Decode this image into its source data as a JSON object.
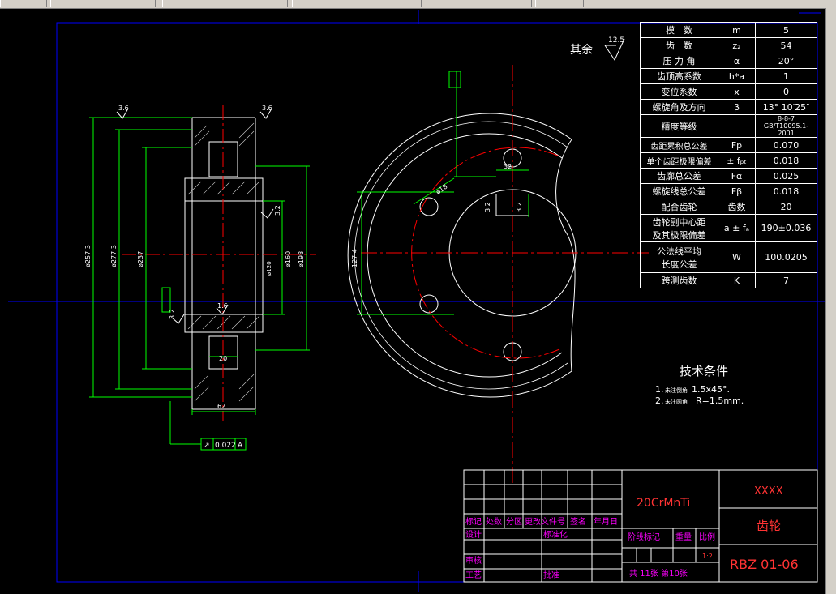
{
  "window": {
    "tabs": [
      "",
      "",
      "",
      "",
      ""
    ],
    "scrollbar": true
  },
  "colors": {
    "background": "#000000",
    "outline": "#ffffff",
    "border": "#0000ff",
    "centerline": "#ff0000",
    "dimension": "#00ff00",
    "text_magenta": "#ff00ff",
    "text_red": "#ff3333",
    "hatch": "#ffffff"
  },
  "roughness": {
    "prefix": "其余",
    "value": "12.5"
  },
  "left_view": {
    "roughness_marks": [
      "3.6",
      "3.6",
      "1.6",
      "3.2",
      "3.2"
    ],
    "dims": {
      "d1": "ø257.3",
      "d2": "ø277.3",
      "d3": "ø237",
      "d4": "ø160",
      "d5": "ø198",
      "d6": "ø120",
      "width": "62",
      "hub": "20"
    },
    "tolerance_box": {
      "symbol": "↗",
      "value": "0.022",
      "datum": "A"
    }
  },
  "right_view": {
    "dim_keyway": "32",
    "dim_angle": "3.2",
    "dim_hole": "ø18",
    "dim_height": "127.4",
    "dim_top": "3.2"
  },
  "spec_table": [
    [
      "模　数",
      "m",
      "5"
    ],
    [
      "齿　数",
      "z₂",
      "54"
    ],
    [
      "压 力 角",
      "α",
      "20°"
    ],
    [
      "齿顶高系数",
      "h*a",
      "1"
    ],
    [
      "变位系数",
      "x",
      "0"
    ],
    [
      "螺旋角及方向",
      "β",
      "13° 10′25″"
    ],
    [
      "精度等级",
      "",
      "8-8-7 GB/T10095.1-2001"
    ],
    [
      "齿距累积总公差",
      "Fp",
      "0.070"
    ],
    [
      "单个齿距极限偏差",
      "± fₚₜ",
      "0.018"
    ],
    [
      "齿廓总公差",
      "Fα",
      "0.025"
    ],
    [
      "螺旋线总公差",
      "Fβ",
      "0.018"
    ],
    [
      "配合齿轮",
      "齿数",
      "20"
    ],
    [
      "齿轮副中心距\n及其极限偏差",
      "a ± fₐ",
      "190±0.036"
    ],
    [
      "公法线平均\n长度公差",
      "W",
      "100.0205"
    ],
    [
      "跨测齿数",
      "K",
      "7"
    ]
  ],
  "tech": {
    "title": "技术条件",
    "line1_num": "1.",
    "line1_small": "未注倒角",
    "line1_val": "1.5x45°.",
    "line2_num": "2.",
    "line2_small": "未注圆角",
    "line2_val": "R=1.5mm."
  },
  "title_block": {
    "material": "20CrMnTi",
    "company": "XXXX",
    "part_name": "齿轮",
    "drawing_no": "RBZ 01-06",
    "scale": "1:2",
    "labels": {
      "mark": "标记",
      "count": "处数",
      "zone": "分区",
      "change_doc": "更改文件号",
      "sign": "签名",
      "date": "年月日",
      "design": "设计",
      "standard": "标准化",
      "stage": "阶段标记",
      "weight": "重量",
      "ratio": "比例",
      "review": "审核",
      "process": "工艺",
      "approve": "批准"
    },
    "sheets": "共 11张 第10张"
  }
}
